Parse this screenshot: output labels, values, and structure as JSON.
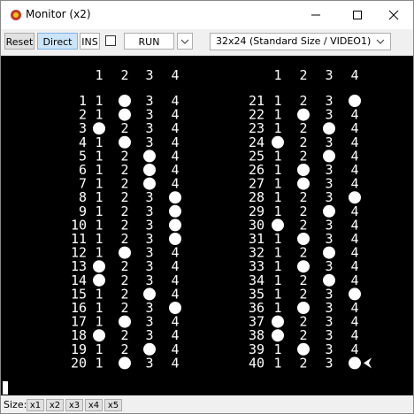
{
  "window": {
    "title": "Monitor (x2)"
  },
  "toolbar": {
    "reset_label": "Reset",
    "direct_label": "Direct",
    "ins_label": "INS",
    "run_label": "RUN",
    "mode_value": "32x24 (Standard Size / VIDEO1)"
  },
  "screen": {
    "col_headers": [
      "1",
      "2",
      "3",
      "4"
    ],
    "left_rows": [
      {
        "n": "1",
        "ball": 2
      },
      {
        "n": "2",
        "ball": 2
      },
      {
        "n": "3",
        "ball": 1
      },
      {
        "n": "4",
        "ball": 2
      },
      {
        "n": "5",
        "ball": 3
      },
      {
        "n": "6",
        "ball": 3
      },
      {
        "n": "7",
        "ball": 3
      },
      {
        "n": "8",
        "ball": 4
      },
      {
        "n": "9",
        "ball": 4
      },
      {
        "n": "10",
        "ball": 4
      },
      {
        "n": "11",
        "ball": 4
      },
      {
        "n": "12",
        "ball": 2
      },
      {
        "n": "13",
        "ball": 1
      },
      {
        "n": "14",
        "ball": 1
      },
      {
        "n": "15",
        "ball": 3
      },
      {
        "n": "16",
        "ball": 4
      },
      {
        "n": "17",
        "ball": 2
      },
      {
        "n": "18",
        "ball": 1
      },
      {
        "n": "19",
        "ball": 3
      },
      {
        "n": "20",
        "ball": 2
      }
    ],
    "right_rows": [
      {
        "n": "21",
        "ball": 4
      },
      {
        "n": "22",
        "ball": 2
      },
      {
        "n": "23",
        "ball": 3
      },
      {
        "n": "24",
        "ball": 1
      },
      {
        "n": "25",
        "ball": 3
      },
      {
        "n": "26",
        "ball": 2
      },
      {
        "n": "27",
        "ball": 2
      },
      {
        "n": "28",
        "ball": 4
      },
      {
        "n": "29",
        "ball": 3
      },
      {
        "n": "30",
        "ball": 1
      },
      {
        "n": "31",
        "ball": 2
      },
      {
        "n": "32",
        "ball": 3
      },
      {
        "n": "33",
        "ball": 2
      },
      {
        "n": "34",
        "ball": 3
      },
      {
        "n": "35",
        "ball": 4
      },
      {
        "n": "36",
        "ball": 2
      },
      {
        "n": "37",
        "ball": 1
      },
      {
        "n": "38",
        "ball": 1
      },
      {
        "n": "39",
        "ball": 2
      },
      {
        "n": "40",
        "ball": 4
      }
    ],
    "cursor_row": 40
  },
  "statusbar": {
    "size_label": "Size:",
    "sizes": [
      "x1",
      "x2",
      "x3",
      "x4",
      "x5"
    ]
  }
}
